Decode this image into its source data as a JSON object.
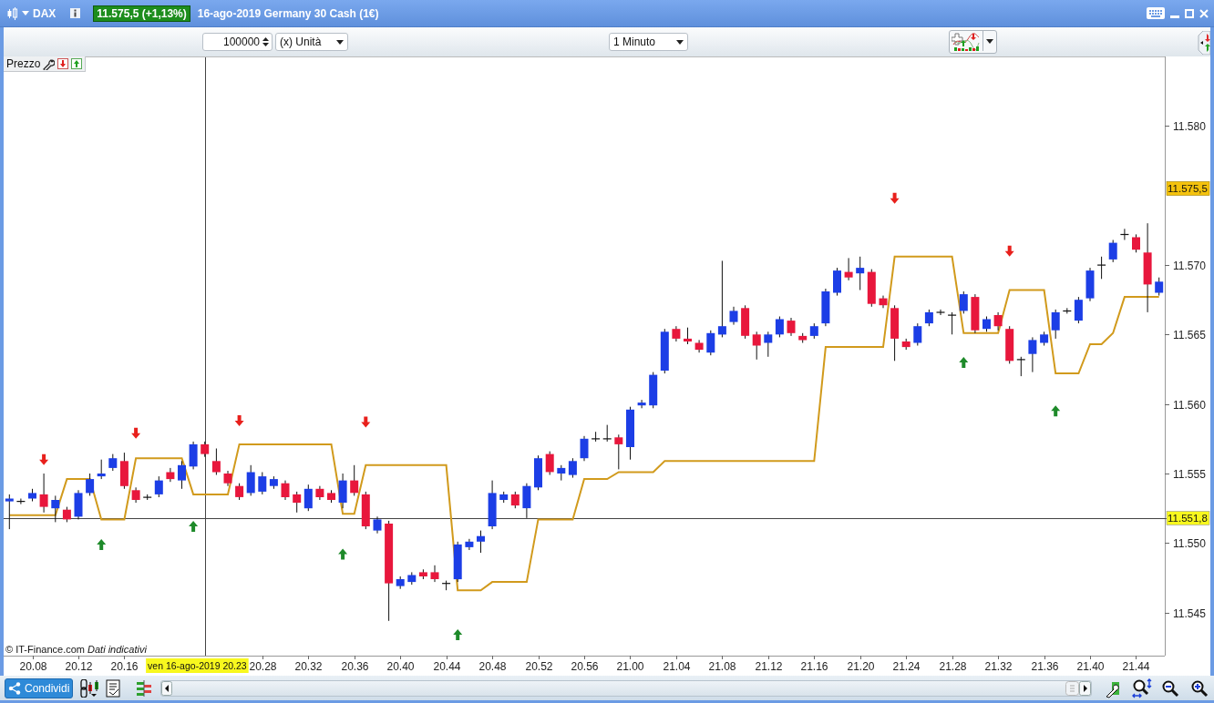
{
  "title_bar": {
    "symbol": "DAX",
    "price_badge": "11.575,5 (+1,13%)",
    "description": "16-ago-2019 Germany 30 Cash (1€)"
  },
  "toolbar": {
    "quantity": "100000",
    "unit": "(x) Unità",
    "timeframe": "1 Minuto"
  },
  "chart": {
    "panel_label": "Prezzo",
    "credit": "© IT-Finance.com *Dati indicativi*",
    "crosshair_time_label": "ven 16-ago-2019 20.23",
    "chart_data": {
      "type": "candlestick",
      "categories": [
        null,
        null,
        "20.08",
        null,
        null,
        null,
        "20.12",
        null,
        null,
        null,
        "20.16",
        null,
        null,
        null,
        null,
        null,
        null,
        null,
        null,
        null,
        null,
        null,
        "20.28",
        null,
        null,
        null,
        "20.32",
        null,
        null,
        null,
        "20.36",
        null,
        null,
        null,
        "20.40",
        null,
        null,
        null,
        "20.44",
        null,
        null,
        null,
        "20.48",
        null,
        null,
        null,
        "20.52",
        null,
        null,
        null,
        "20.56",
        null,
        null,
        null,
        "21.00",
        null,
        null,
        null,
        "21.04",
        null,
        null,
        null,
        "21.08",
        null,
        null,
        null,
        "21.12",
        null,
        null,
        null,
        "21.16",
        null,
        null,
        null,
        "21.20",
        null,
        null,
        null,
        "21.24",
        null,
        null,
        null,
        "21.28",
        null,
        null,
        null,
        "21.32",
        null,
        null,
        null,
        "21.36",
        null,
        null,
        null,
        "21.40",
        null,
        null,
        null,
        "21.44",
        null,
        null
      ],
      "ohlc": [
        [
          11.553,
          11.5535,
          11.551,
          11.5532
        ],
        [
          11.553,
          11.5532,
          11.5528,
          11.553
        ],
        [
          11.5532,
          11.5539,
          11.553,
          11.5536
        ],
        [
          11.5535,
          11.555,
          11.5522,
          11.5526
        ],
        [
          11.5525,
          11.5534,
          11.5515,
          11.5531
        ],
        [
          11.5524,
          11.5526,
          11.5515,
          11.5517
        ],
        [
          11.5519,
          11.5538,
          11.5517,
          11.5536
        ],
        [
          11.5536,
          11.555,
          11.5534,
          11.5546
        ],
        [
          11.5548,
          11.556,
          11.5546,
          11.555
        ],
        [
          11.5554,
          11.5564,
          11.5552,
          11.5561
        ],
        [
          11.5559,
          11.5565,
          11.5539,
          11.5541
        ],
        [
          11.5538,
          11.554,
          11.5529,
          11.5531
        ],
        [
          11.5533,
          11.5535,
          11.5531,
          11.5533
        ],
        [
          11.5535,
          11.5548,
          11.5533,
          11.5545
        ],
        [
          11.5551,
          11.5554,
          11.5544,
          11.5546
        ],
        [
          11.5545,
          11.5559,
          11.5539,
          11.5556
        ],
        [
          11.5555,
          11.5573,
          11.5553,
          11.5571
        ],
        [
          11.5571,
          11.5573,
          11.5562,
          11.5564
        ],
        [
          11.5559,
          11.5568,
          11.5549,
          11.5551
        ],
        [
          11.555,
          11.5552,
          11.5541,
          11.5543
        ],
        [
          11.5541,
          11.5543,
          11.5531,
          11.5533
        ],
        [
          11.5536,
          11.5556,
          11.5534,
          11.5551
        ],
        [
          11.5537,
          11.5551,
          11.5535,
          11.5548
        ],
        [
          11.5541,
          11.5548,
          11.5539,
          11.5546
        ],
        [
          11.5543,
          11.5545,
          11.5531,
          11.5533
        ],
        [
          11.5535,
          11.5537,
          11.5522,
          11.5529
        ],
        [
          11.5525,
          11.5542,
          11.5523,
          11.5539
        ],
        [
          11.5539,
          11.5541,
          11.5531,
          11.5533
        ],
        [
          11.5536,
          11.5538,
          11.5529,
          11.5531
        ],
        [
          11.5529,
          11.555,
          11.5525,
          11.5545
        ],
        [
          11.5545,
          11.5556,
          11.5534,
          11.5536
        ],
        [
          11.5535,
          11.5537,
          11.551,
          11.5512
        ],
        [
          11.5509,
          11.5519,
          11.5507,
          11.5517
        ],
        [
          11.5514,
          11.5516,
          11.5444,
          11.5471
        ],
        [
          11.5469,
          11.5476,
          11.5467,
          11.5474
        ],
        [
          11.5472,
          11.5479,
          11.547,
          11.5477
        ],
        [
          11.5479,
          11.5481,
          11.5474,
          11.5476
        ],
        [
          11.5479,
          11.5484,
          11.5472,
          11.5474
        ],
        [
          11.5471,
          11.5473,
          11.5466,
          11.5471
        ],
        [
          11.5474,
          11.5501,
          11.5472,
          11.5499
        ],
        [
          11.5497,
          11.5503,
          11.5495,
          11.5501
        ],
        [
          11.5501,
          11.5509,
          11.5493,
          11.5505
        ],
        [
          11.5512,
          11.5545,
          11.551,
          11.5536
        ],
        [
          11.5531,
          11.5537,
          11.5529,
          11.5535
        ],
        [
          11.5535,
          11.5537,
          11.5525,
          11.5527
        ],
        [
          11.5525,
          11.5543,
          11.5518,
          11.5541
        ],
        [
          11.554,
          11.5563,
          11.5538,
          11.5561
        ],
        [
          11.5564,
          11.5566,
          11.5549,
          11.5551
        ],
        [
          11.555,
          11.5556,
          11.5545,
          11.5554
        ],
        [
          11.5549,
          11.5561,
          11.5547,
          11.5559
        ],
        [
          11.5561,
          11.5577,
          11.5559,
          11.5575
        ],
        [
          11.5575,
          11.558,
          11.5573,
          11.5575
        ],
        [
          11.5575,
          11.5585,
          11.5573,
          11.5575
        ],
        [
          11.5576,
          11.5578,
          11.5553,
          11.5571
        ],
        [
          11.5569,
          11.5598,
          11.556,
          11.5596
        ],
        [
          11.5599,
          11.5603,
          11.5597,
          11.5601
        ],
        [
          11.5599,
          11.5623,
          11.5597,
          11.5621
        ],
        [
          11.5624,
          11.5654,
          11.5622,
          11.5652
        ],
        [
          11.5654,
          11.5656,
          11.5645,
          11.5647
        ],
        [
          11.5647,
          11.5655,
          11.5643,
          11.5645
        ],
        [
          11.5644,
          11.5646,
          11.5637,
          11.5639
        ],
        [
          11.5637,
          11.5653,
          11.5635,
          11.5651
        ],
        [
          11.565,
          11.5703,
          11.5648,
          11.5656
        ],
        [
          11.5659,
          11.567,
          11.5657,
          11.5667
        ],
        [
          11.5669,
          11.5671,
          11.5647,
          11.5649
        ],
        [
          11.565,
          11.5652,
          11.5632,
          11.5642
        ],
        [
          11.5644,
          11.5652,
          11.5634,
          11.565
        ],
        [
          11.565,
          11.5663,
          11.5648,
          11.5661
        ],
        [
          11.566,
          11.5662,
          11.5649,
          11.5651
        ],
        [
          11.5649,
          11.5651,
          11.5644,
          11.5646
        ],
        [
          11.5649,
          11.5658,
          11.5647,
          11.5656
        ],
        [
          11.5658,
          11.5683,
          11.5656,
          11.5681
        ],
        [
          11.568,
          11.5698,
          11.5678,
          11.5696
        ],
        [
          11.5695,
          11.5705,
          11.5689,
          11.5691
        ],
        [
          11.5694,
          11.5706,
          11.5682,
          11.5698
        ],
        [
          11.5695,
          11.5697,
          11.567,
          11.5672
        ],
        [
          11.5676,
          11.5678,
          11.5669,
          11.5671
        ],
        [
          11.5669,
          11.5671,
          11.5631,
          11.5647
        ],
        [
          11.5645,
          11.5647,
          11.5639,
          11.5641
        ],
        [
          11.5644,
          11.5658,
          11.5642,
          11.5656
        ],
        [
          11.5658,
          11.5668,
          11.5656,
          11.5666
        ],
        [
          11.5666,
          11.5668,
          11.5664,
          11.5666
        ],
        [
          11.5664,
          11.5666,
          11.565,
          11.5664
        ],
        [
          11.5667,
          11.5681,
          11.5665,
          11.5679
        ],
        [
          11.5677,
          11.5679,
          11.5651,
          11.5653
        ],
        [
          11.5654,
          11.5663,
          11.5652,
          11.5661
        ],
        [
          11.5664,
          11.5666,
          11.5653,
          11.5656
        ],
        [
          11.5654,
          11.5656,
          11.5629,
          11.5631
        ],
        [
          11.5632,
          11.5634,
          11.562,
          11.5632
        ],
        [
          11.5636,
          11.5648,
          11.5623,
          11.5646
        ],
        [
          11.5644,
          11.5652,
          11.5642,
          11.565
        ],
        [
          11.5653,
          11.5668,
          11.5647,
          11.5666
        ],
        [
          11.5667,
          11.5669,
          11.5665,
          11.5667
        ],
        [
          11.566,
          11.5677,
          11.5658,
          11.5675
        ],
        [
          11.5676,
          11.5698,
          11.5674,
          11.5696
        ],
        [
          11.57,
          11.5706,
          11.569,
          11.57
        ],
        [
          11.5704,
          11.5718,
          11.5702,
          11.5716
        ],
        [
          11.5722,
          11.5726,
          11.5718,
          11.5722
        ],
        [
          11.572,
          11.5722,
          11.5709,
          11.5711
        ],
        [
          11.5709,
          11.573,
          11.5666,
          11.5686
        ],
        [
          11.568,
          11.5691,
          11.5678,
          11.5688
        ]
      ],
      "series": [
        {
          "type": "line",
          "color": "#d19a1c",
          "values": [
            11.552,
            11.552,
            11.552,
            11.552,
            11.552,
            11.5546,
            11.5546,
            11.5546,
            11.5517,
            11.5517,
            11.5517,
            11.5561,
            11.5561,
            11.5561,
            11.5561,
            11.5561,
            11.5535,
            11.5535,
            11.5535,
            11.5535,
            11.5571,
            11.5571,
            11.5571,
            11.5571,
            11.5571,
            11.5571,
            11.5571,
            11.5571,
            11.5571,
            11.5521,
            11.5521,
            11.5556,
            11.5556,
            11.5556,
            11.5556,
            11.5556,
            11.5556,
            11.5556,
            11.5556,
            11.5466,
            11.5466,
            11.5466,
            11.5472,
            11.5472,
            11.5472,
            11.5472,
            11.5517,
            11.5517,
            11.5517,
            11.5517,
            11.5546,
            11.5546,
            11.5546,
            11.5551,
            11.5551,
            11.5551,
            11.5551,
            11.5559,
            11.5559,
            11.5559,
            11.5559,
            11.5559,
            11.5559,
            11.5559,
            11.5559,
            11.5559,
            11.5559,
            11.5559,
            11.5559,
            11.5559,
            11.5559,
            11.5641,
            11.5641,
            11.5641,
            11.5641,
            11.5641,
            11.5641,
            11.5706,
            11.5706,
            11.5706,
            11.5706,
            11.5706,
            11.5706,
            11.5651,
            11.5651,
            11.5651,
            11.5651,
            11.5682,
            11.5682,
            11.5682,
            11.5682,
            11.5622,
            11.5622,
            11.5622,
            11.5643,
            11.5643,
            11.5651,
            11.5677,
            11.5677,
            11.5677,
            11.5677
          ]
        },
        {
          "type": "scatter",
          "color": "#e8201c",
          "values": [
            null,
            null,
            null,
            11.556,
            null,
            null,
            null,
            null,
            null,
            null,
            null,
            11.5579,
            null,
            null,
            null,
            null,
            null,
            null,
            null,
            null,
            11.5588,
            null,
            null,
            null,
            null,
            null,
            null,
            null,
            null,
            null,
            null,
            11.5587,
            null,
            null,
            null,
            null,
            null,
            null,
            null,
            null,
            null,
            null,
            null,
            null,
            null,
            null,
            null,
            null,
            null,
            null,
            null,
            null,
            null,
            null,
            null,
            null,
            null,
            null,
            null,
            null,
            null,
            null,
            null,
            null,
            null,
            null,
            null,
            null,
            null,
            null,
            null,
            null,
            null,
            null,
            null,
            null,
            null,
            11.5748,
            null,
            null,
            null,
            null,
            null,
            null,
            null,
            null,
            null,
            11.571,
            null,
            null,
            null,
            null,
            null,
            null,
            null,
            null,
            null,
            null,
            null,
            null,
            null
          ]
        },
        {
          "type": "scatter",
          "color": "#1e8a2a",
          "values": [
            null,
            null,
            null,
            null,
            null,
            null,
            null,
            null,
            11.5499,
            null,
            null,
            null,
            null,
            null,
            null,
            null,
            11.5512,
            null,
            null,
            null,
            null,
            null,
            null,
            null,
            null,
            null,
            null,
            null,
            null,
            11.5492,
            null,
            null,
            null,
            null,
            null,
            null,
            null,
            null,
            null,
            11.5434,
            null,
            null,
            null,
            null,
            null,
            null,
            null,
            null,
            null,
            null,
            null,
            null,
            null,
            null,
            null,
            null,
            null,
            null,
            null,
            null,
            null,
            null,
            null,
            null,
            null,
            null,
            null,
            null,
            null,
            null,
            null,
            null,
            null,
            null,
            null,
            null,
            null,
            null,
            null,
            null,
            null,
            null,
            null,
            11.563,
            null,
            null,
            null,
            null,
            null,
            null,
            null,
            11.5595,
            null,
            null,
            null,
            null,
            null,
            null,
            null,
            null,
            null
          ]
        }
      ],
      "ylim": [
        11.5419,
        11.585
      ],
      "yticks": [
        {
          "value": 11.545,
          "label": "11.545"
        },
        {
          "value": 11.55,
          "label": "11.550"
        },
        {
          "value": 11.555,
          "label": "11.555"
        },
        {
          "value": 11.56,
          "label": "11.560"
        },
        {
          "value": 11.565,
          "label": "11.565"
        },
        {
          "value": 11.57,
          "label": "11.570"
        },
        {
          "value": 11.58,
          "label": "11.580"
        }
      ],
      "ref_lines": [
        {
          "axis": "y",
          "value": 11.5518,
          "label": "11.551,8"
        }
      ],
      "annotations": [
        "11.575,5"
      ]
    }
  },
  "bottom_bar": {
    "share_button": "Condividi"
  }
}
